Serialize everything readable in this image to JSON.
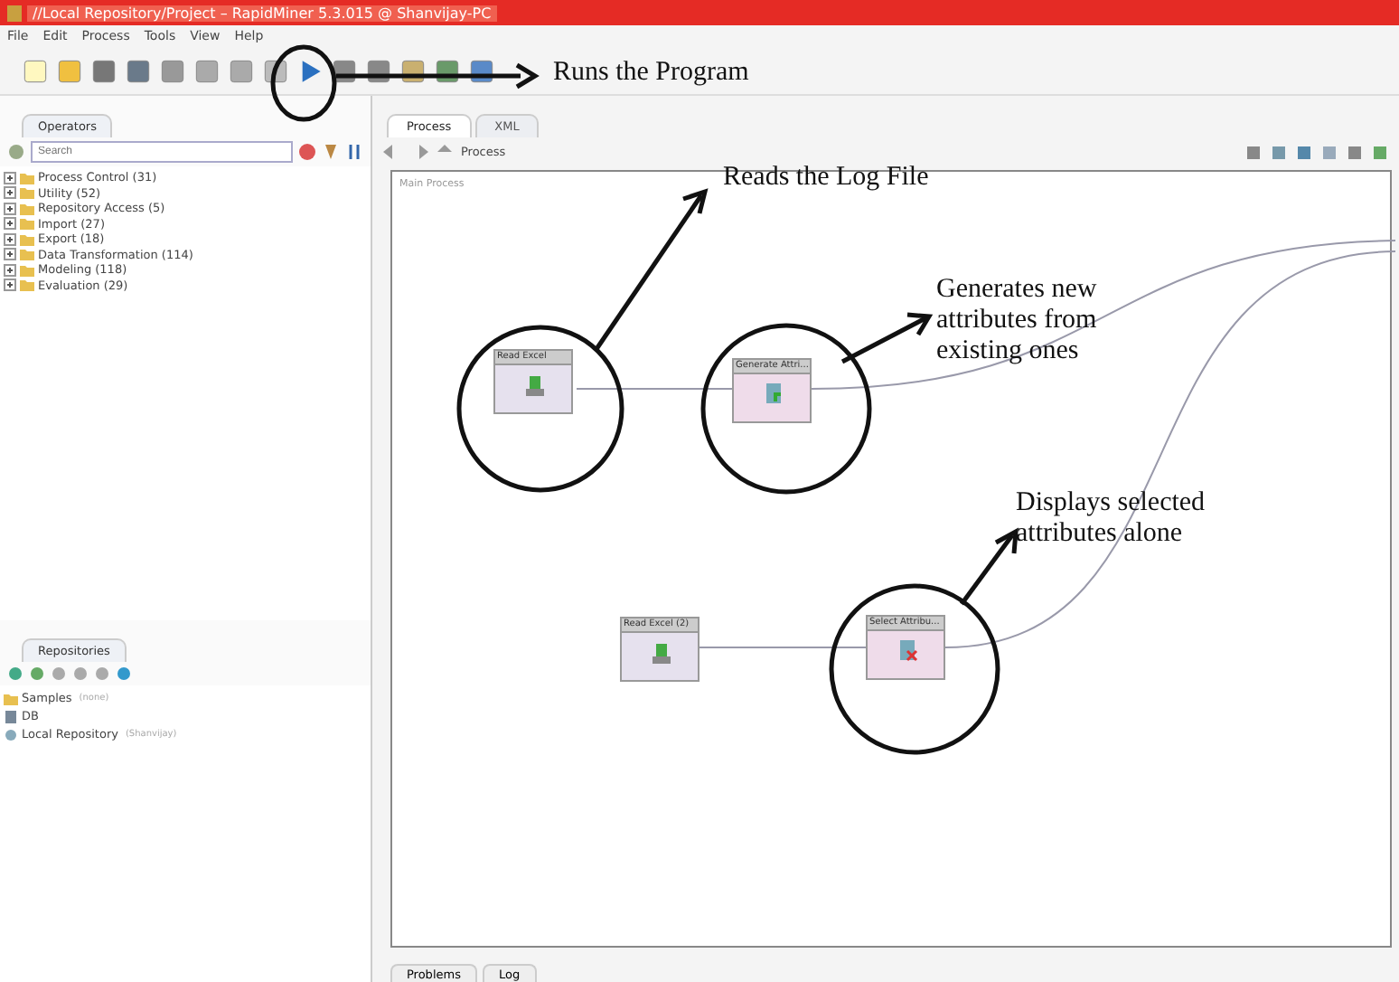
{
  "window": {
    "title": "//Local Repository/Project – RapidMiner 5.3.015 @ Shanvijay-PC"
  },
  "menu": [
    "File",
    "Edit",
    "Process",
    "Tools",
    "View",
    "Help"
  ],
  "operators_panel": {
    "tab": "Operators",
    "search": {
      "placeholder": "Search"
    },
    "tree": [
      {
        "label": "Process Control (31)",
        "expanded": false
      },
      {
        "label": "Utility (52)",
        "expanded": false
      },
      {
        "label": "Repository Access (5)",
        "expanded": false
      },
      {
        "label": "Import (27)",
        "expanded": false
      },
      {
        "label": "Export (18)",
        "expanded": false
      },
      {
        "label": "Data Transformation (114)",
        "expanded": false
      },
      {
        "label": "Modeling (118)",
        "expanded": false
      },
      {
        "label": "Evaluation (29)",
        "expanded": false
      }
    ]
  },
  "repositories_panel": {
    "tab": "Repositories",
    "tree": [
      {
        "label": "Samples",
        "note": "(none)",
        "kind": "samples"
      },
      {
        "label": "DB",
        "kind": "db"
      },
      {
        "label": "Local Repository",
        "note": "(Shanvijay)",
        "kind": "local"
      }
    ]
  },
  "editor_tabs": [
    {
      "label": "Process",
      "selected": true
    },
    {
      "label": "XML",
      "selected": false
    }
  ],
  "breadcrumb": "Process",
  "process": {
    "title": "Main Process",
    "operators": [
      {
        "name": "Read Excel",
        "kind": "read"
      },
      {
        "name": "Generate Attri...",
        "kind": "generate"
      },
      {
        "name": "Read Excel (2)",
        "kind": "read"
      },
      {
        "name": "Select Attribu...",
        "kind": "select"
      }
    ]
  },
  "annotations": [
    "Runs the Program",
    "Reads the Log File",
    "Generates new attributes from existing ones",
    "Displays selected attributes alone"
  ],
  "bottom_tabs": [
    "Problems",
    "Log"
  ]
}
